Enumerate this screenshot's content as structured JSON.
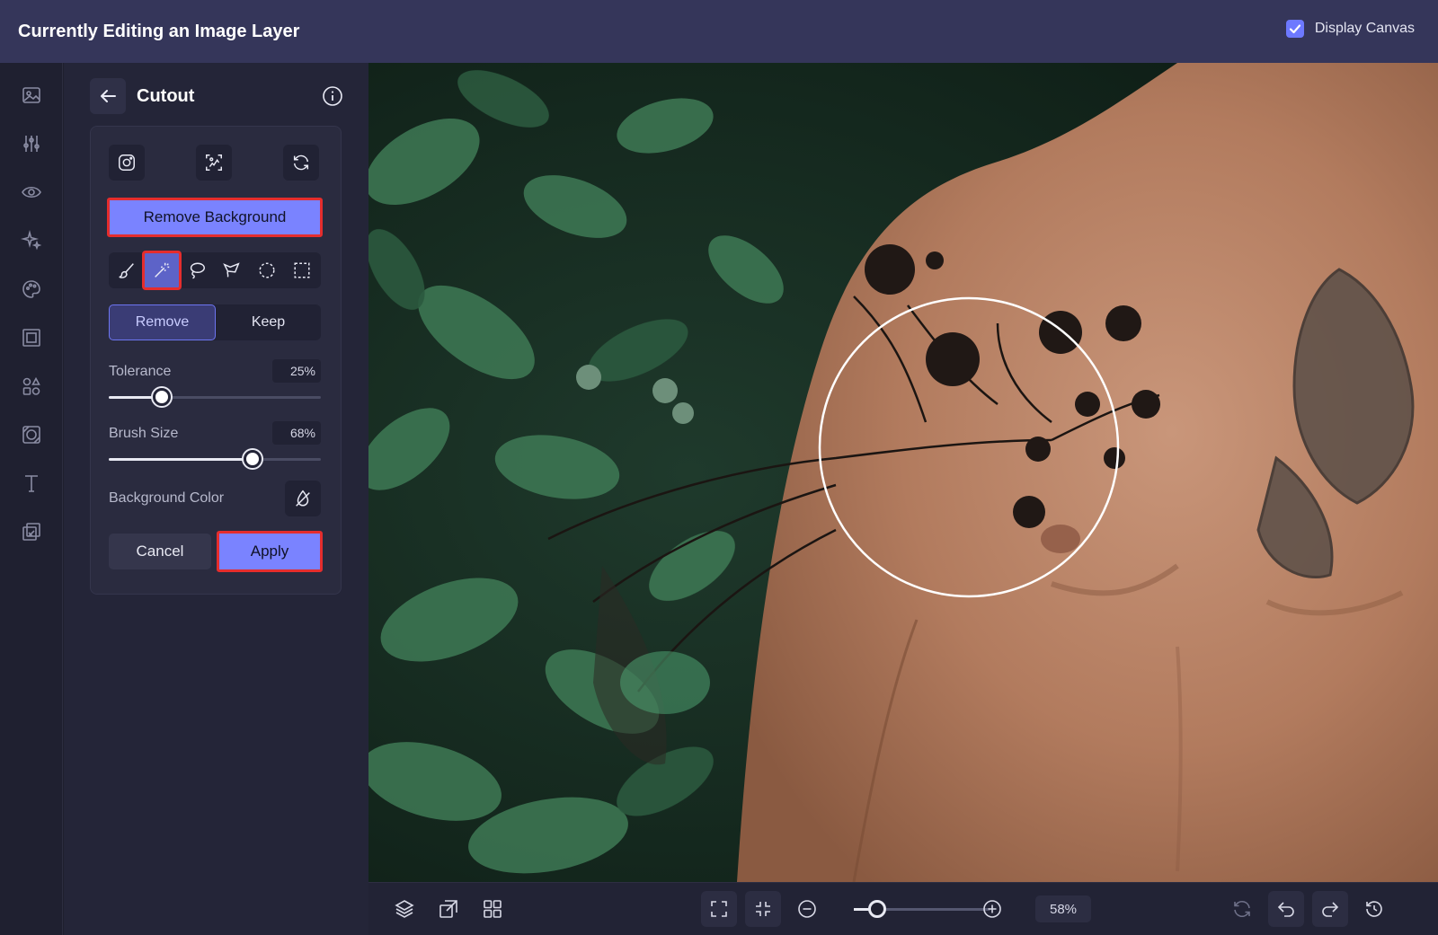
{
  "topbar": {
    "title": "Currently Editing an Image Layer",
    "display_canvas_label": "Display Canvas",
    "display_canvas_checked": true
  },
  "rail": {
    "icons": [
      "image-icon",
      "adjustments-icon",
      "eye-icon",
      "sparkles-icon",
      "palette-icon",
      "frame-icon",
      "elements-icon",
      "texture-icon",
      "text-icon",
      "overlay-icon"
    ]
  },
  "panel": {
    "title": "Cutout",
    "tools": [
      "instagram-icon",
      "cutout-icon",
      "refresh-icon"
    ],
    "remove_background_label": "Remove Background",
    "selection_tools": [
      "brush-icon",
      "magic-wand-icon",
      "lasso-icon",
      "polygon-lasso-icon",
      "ellipse-select-icon",
      "rect-select-icon"
    ],
    "active_selection_tool": "magic-wand-icon",
    "mode": {
      "remove_label": "Remove",
      "keep_label": "Keep",
      "active": "Remove"
    },
    "tolerance": {
      "label": "Tolerance",
      "value_text": "25%",
      "value": 0.25
    },
    "brush_size": {
      "label": "Brush Size",
      "value_text": "68%",
      "value": 0.68
    },
    "background_color_label": "Background Color",
    "cancel_label": "Cancel",
    "apply_label": "Apply"
  },
  "bottombar": {
    "left_icons": [
      "layers-icon",
      "resize-icon",
      "grid-icon"
    ],
    "fit_icons": [
      "fullscreen-icon",
      "fit-screen-icon"
    ],
    "zoom_text": "58%",
    "zoom": 0.17,
    "right_icons": [
      "reset-icon",
      "undo-icon",
      "redo-icon",
      "history-icon"
    ]
  },
  "colors": {
    "accent": "#7a83ff",
    "highlight_outline": "#e52d2d",
    "topbar_bg": "#35365a",
    "panel_bg": "#242538"
  }
}
